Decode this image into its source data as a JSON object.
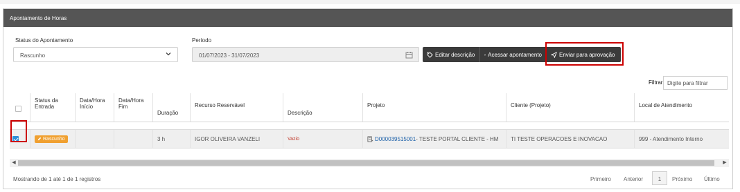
{
  "panel": {
    "title": "Apontamento de Horas"
  },
  "filters": {
    "status_label": "Status do Apontamento",
    "status_value": "Rascunho",
    "period_label": "Período",
    "period_value": "01/07/2023 - 31/07/2023"
  },
  "actions": {
    "edit_description": "Editar descrição",
    "access": "Acessar apontamento",
    "send_approval": "Enviar para aprovação"
  },
  "table_filter": {
    "label": "Filtrar",
    "placeholder": "Digite para filtrar"
  },
  "columns": {
    "status_entrada": "Status da Entrada",
    "inicio": "Data/Hora Início",
    "fim": "Data/Hora Fim",
    "duracao": "Duração",
    "recurso": "Recurso Reservável",
    "descricao": "Descrição",
    "projeto": "Projeto",
    "cliente": "Cliente (Projeto)",
    "local": "Local de Atendimento"
  },
  "rows": [
    {
      "status": "Rascunho",
      "inicio": "",
      "fim": "",
      "duracao": "3 h",
      "recurso": "IGOR OLIVEIRA VANZELI",
      "descricao": "Vazio",
      "projeto_code": "D000039515001",
      "projeto_name": " - TESTE PORTAL CLIENTE - HM",
      "cliente": "TI TESTE OPERACOES E INOVACAO",
      "local": "999 - Atendimento Interno"
    }
  ],
  "footer": {
    "info": "Mostrando de 1 até 1 de 1 registros",
    "first": "Primeiro",
    "prev": "Anterior",
    "page": "1",
    "next": "Próximo",
    "last": "Último"
  },
  "colors": {
    "header_bg": "#555555",
    "button_bg": "#3b3b3b",
    "highlight": "#cc0000",
    "badge": "#f0a030",
    "link": "#1a5fa8"
  }
}
